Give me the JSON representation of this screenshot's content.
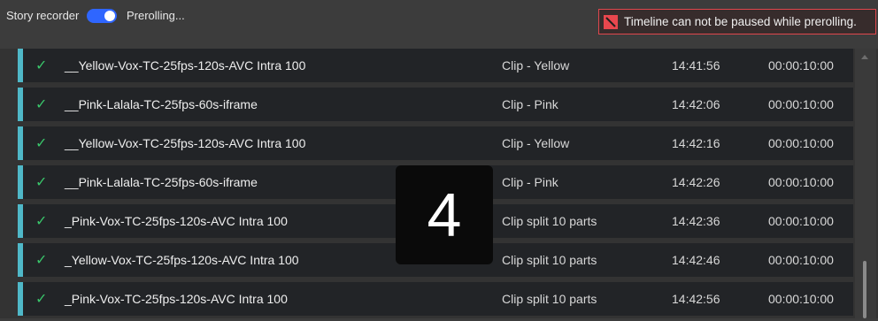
{
  "header": {
    "story_recorder_label": "Story recorder",
    "toggle_state": "on",
    "status_text": "Prerolling...",
    "alert_text": "Timeline can not be paused while prerolling."
  },
  "colors": {
    "accent_toggle": "#2f66ff",
    "row_stripe": "#4fb8c8",
    "check": "#39c56a",
    "alert": "#e0474d"
  },
  "clips": [
    {
      "name": "__Yellow-Vox-TC-25fps-120s-AVC Intra 100",
      "type": "Clip - Yellow",
      "time": "14:41:56",
      "duration": "00:00:10:00"
    },
    {
      "name": "__Pink-Lalala-TC-25fps-60s-iframe",
      "type": "Clip - Pink",
      "time": "14:42:06",
      "duration": "00:00:10:00"
    },
    {
      "name": "__Yellow-Vox-TC-25fps-120s-AVC Intra 100",
      "type": "Clip - Yellow",
      "time": "14:42:16",
      "duration": "00:00:10:00"
    },
    {
      "name": "__Pink-Lalala-TC-25fps-60s-iframe",
      "type": "Clip - Pink",
      "time": "14:42:26",
      "duration": "00:00:10:00"
    },
    {
      "name": "_Pink-Vox-TC-25fps-120s-AVC Intra 100",
      "type": "Clip split 10 parts",
      "time": "14:42:36",
      "duration": "00:00:10:00"
    },
    {
      "name": "_Yellow-Vox-TC-25fps-120s-AVC Intra 100",
      "type": "Clip split 10 parts",
      "time": "14:42:46",
      "duration": "00:00:10:00"
    },
    {
      "name": "_Pink-Vox-TC-25fps-120s-AVC Intra 100",
      "type": "Clip split 10 parts",
      "time": "14:42:56",
      "duration": "00:00:10:00"
    }
  ],
  "row_icon": "check-icon",
  "countdown": "4"
}
